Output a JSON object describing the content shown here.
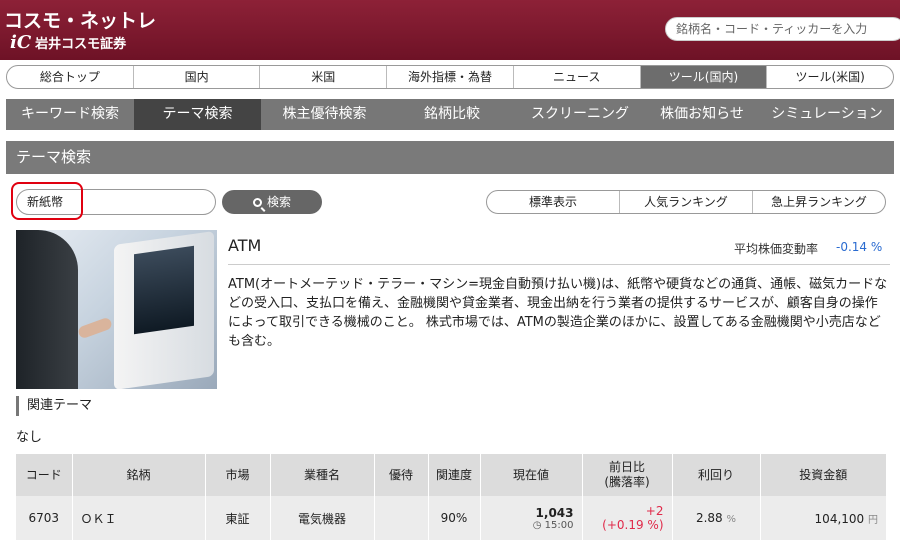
{
  "header": {
    "logo_main": "コスモ・ネットレ",
    "logo_sub": "岩井コスモ証券",
    "search_placeholder": "銘柄名・コード・ティッカーを入力"
  },
  "nav_main": [
    "総合トップ",
    "国内",
    "米国",
    "海外指標・為替",
    "ニュース",
    "ツール(国内)",
    "ツール(米国)"
  ],
  "nav_main_active": "ツール(国内)",
  "nav_sub": [
    "キーワード検索",
    "テーマ検索",
    "株主優待検索",
    "銘柄比較",
    "スクリーニング",
    "株価お知らせ",
    "シミュレーション"
  ],
  "nav_sub_active": "テーマ検索",
  "section_title": "テーマ検索",
  "search": {
    "value": "新紙幣",
    "button_label": "検索"
  },
  "rank_tabs": [
    "標準表示",
    "人気ランキング",
    "急上昇ランキング"
  ],
  "theme": {
    "title": "ATM",
    "avg_label": "平均株価変動率",
    "avg_value": "-0.14 %",
    "description": "ATM(オートメーテッド・テラー・マシン=現金自動預け払い機)は、紙幣や硬貨などの通貨、通帳、磁気カードなどの受入口、支払口を備え、金融機関や貸金業者、現金出納を行う業者の提供するサービスが、顧客自身の操作によって取引できる機械のこと。 株式市場では、ATMの製造企業のほかに、設置してある金融機関や小売店なども含む。"
  },
  "related": {
    "heading": "関連テーマ",
    "value": "なし"
  },
  "table": {
    "headers": [
      "コード",
      "銘柄",
      "市場",
      "業種名",
      "優待",
      "関連度",
      "現在値",
      "前日比\n(騰落率)",
      "利回り",
      "投資金額"
    ],
    "rows": [
      {
        "code": "6703",
        "name": "ＯＫＩ",
        "market": "東証",
        "industry": "電気機器",
        "yutai": "",
        "relevance": "90%",
        "price": "1,043",
        "price_time": "15:00",
        "change": "+2",
        "change_pct": "(+0.19 %)",
        "yield": "2.88",
        "yield_unit": "%",
        "investment": "104,100",
        "investment_unit": "円"
      }
    ]
  }
}
